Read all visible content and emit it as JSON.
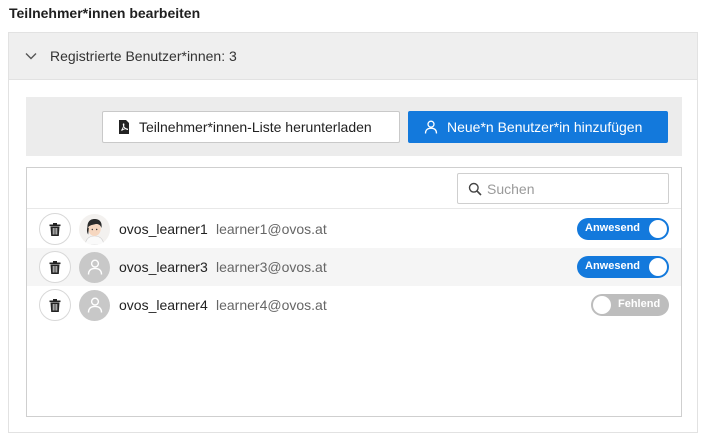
{
  "page": {
    "title": "Teilnehmer*innen bearbeiten"
  },
  "section": {
    "header_label": "Registrierte Benutzer*innen: 3",
    "expanded_icon": "chevron-down-icon"
  },
  "toolbar": {
    "download_label": "Teilnehmer*innen-Liste herunterladen",
    "download_icon": "pdf-file-icon",
    "add_label": "Neue*n Benutzer*in hinzufügen",
    "add_icon": "user-icon"
  },
  "search": {
    "placeholder": "Suchen",
    "value": ""
  },
  "participants": [
    {
      "username": "ovos_learner1",
      "email": "learner1@ovos.at",
      "status": "Anwesend",
      "present": true,
      "avatar": "photo"
    },
    {
      "username": "ovos_learner3",
      "email": "learner3@ovos.at",
      "status": "Anwesend",
      "present": true,
      "avatar": "placeholder"
    },
    {
      "username": "ovos_learner4",
      "email": "learner4@ovos.at",
      "status": "Fehlend",
      "present": false,
      "avatar": "placeholder"
    }
  ],
  "colors": {
    "accent": "#1379dc",
    "toggle_off": "#bdbdbd",
    "header_bg": "#efefef"
  }
}
